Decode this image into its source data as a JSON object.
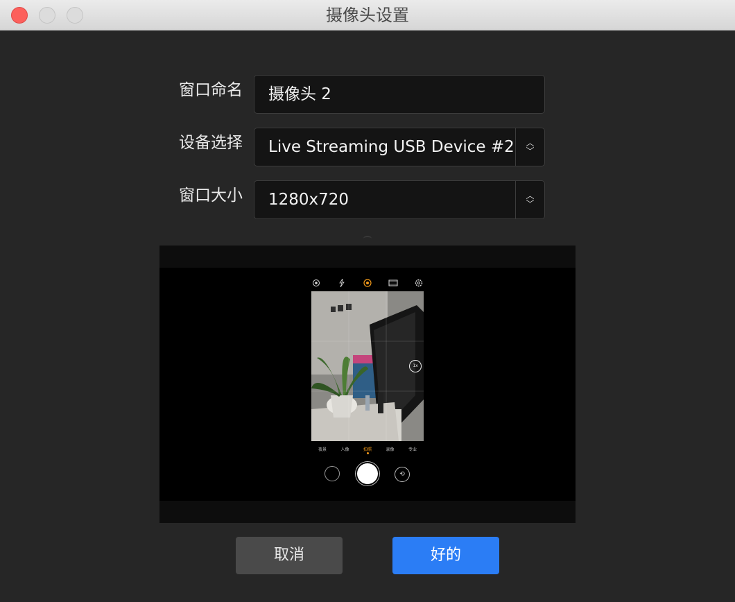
{
  "window": {
    "title": "摄像头设置"
  },
  "form": {
    "name_label": "窗口命名",
    "name_value": "摄像头 2",
    "device_label": "设备选择",
    "device_value": "Live Streaming USB Device #2",
    "size_label": "窗口大小",
    "size_value": "1280x720"
  },
  "preview": {
    "zoom_label": "1x",
    "modes": [
      "夜景",
      "人像",
      "拍照",
      "录像",
      "专业"
    ],
    "active_mode": "拍照",
    "icons": [
      "eye-icon",
      "flash-icon",
      "hdr-icon",
      "aspect-ratio-icon",
      "settings-icon"
    ]
  },
  "buttons": {
    "cancel": "取消",
    "ok": "好的"
  },
  "colors": {
    "accent": "#2b7df5",
    "close": "#fc605c",
    "camera_highlight": "#f39a1a"
  }
}
